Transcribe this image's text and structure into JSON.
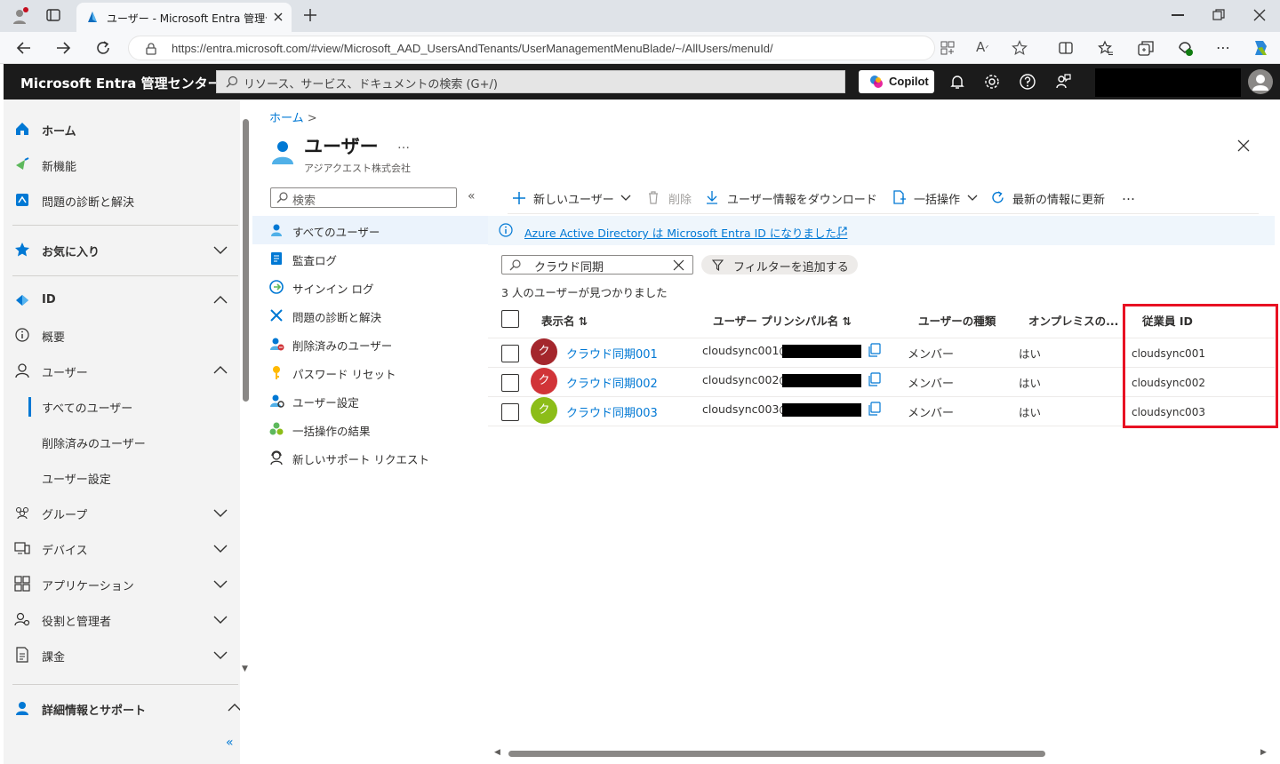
{
  "browser": {
    "tab_title": "ユーザー - Microsoft Entra 管理センター",
    "url": "https://entra.microsoft.com/#view/Microsoft_AAD_UsersAndTenants/UserManagementMenuBlade/~/AllUsers/menuId/"
  },
  "header": {
    "brand": "Microsoft Entra 管理センター",
    "search_placeholder": "リソース、サービス、ドキュメントの検索 (G+/)",
    "copilot_label": "Copilot"
  },
  "leftnav": {
    "items": [
      {
        "label": "ホーム",
        "icon": "home-icon"
      },
      {
        "label": "新機能",
        "icon": "whats-new-icon"
      },
      {
        "label": "問題の診断と解決",
        "icon": "diagnose-icon"
      },
      {
        "label": "お気に入り",
        "icon": "star-icon"
      },
      {
        "label": "ID",
        "icon": "identity-icon"
      },
      {
        "label": "概要",
        "icon": "info-icon"
      },
      {
        "label": "ユーザー",
        "icon": "user-icon"
      },
      {
        "label": "すべてのユーザー"
      },
      {
        "label": "削除済みのユーザー"
      },
      {
        "label": "ユーザー設定"
      },
      {
        "label": "グループ",
        "icon": "groups-icon"
      },
      {
        "label": "デバイス",
        "icon": "devices-icon"
      },
      {
        "label": "アプリケーション",
        "icon": "apps-icon"
      },
      {
        "label": "役割と管理者",
        "icon": "roles-icon"
      },
      {
        "label": "課金",
        "icon": "billing-icon"
      },
      {
        "label": "詳細情報とサポート",
        "icon": "support-icon"
      }
    ]
  },
  "page": {
    "breadcrumb": "ホーム",
    "title": "ユーザー",
    "subtitle": "アジアクエスト株式会社",
    "search_placeholder": "検索"
  },
  "blade_menu": [
    {
      "label": "すべてのユーザー",
      "icon": "user-icon"
    },
    {
      "label": "監査ログ",
      "icon": "audit-log-icon"
    },
    {
      "label": "サインイン ログ",
      "icon": "signin-log-icon"
    },
    {
      "label": "問題の診断と解決",
      "icon": "diagnose-icon"
    },
    {
      "label": "削除済みのユーザー",
      "icon": "deleted-user-icon"
    },
    {
      "label": "パスワード リセット",
      "icon": "key-icon"
    },
    {
      "label": "ユーザー設定",
      "icon": "user-settings-icon"
    },
    {
      "label": "一括操作の結果",
      "icon": "bulk-results-icon"
    },
    {
      "label": "新しいサポート リクエスト",
      "icon": "support-request-icon"
    }
  ],
  "toolbar": {
    "new_user": "新しいユーザー",
    "delete": "削除",
    "download": "ユーザー情報をダウンロード",
    "bulk": "一括操作",
    "refresh": "最新の情報に更新",
    "more": "…"
  },
  "banner": "Azure Active Directory は Microsoft Entra ID になりました。",
  "filter": {
    "value": "クラウド同期",
    "add_filter": "フィルターを追加する"
  },
  "result_count": "3 人のユーザーが見つかりました",
  "table": {
    "headers": [
      "表示名 ⇅",
      "ユーザー プリンシパル名 ⇅",
      "ユーザーの種類",
      "オンプレミスの...",
      "従業員 ID"
    ],
    "rows": [
      {
        "initial": "ク",
        "avatar_color": "#a4262c",
        "name": "クラウド同期001",
        "upn": "cloudsync001@",
        "type": "メンバー",
        "onprem": "はい",
        "employee_id": "cloudsync001"
      },
      {
        "initial": "ク",
        "avatar_color": "#d13438",
        "name": "クラウド同期002",
        "upn": "cloudsync002@",
        "type": "メンバー",
        "onprem": "はい",
        "employee_id": "cloudsync002"
      },
      {
        "initial": "ク",
        "avatar_color": "#8cbd18",
        "name": "クラウド同期003",
        "upn": "cloudsync003@",
        "type": "メンバー",
        "onprem": "はい",
        "employee_id": "cloudsync003"
      }
    ]
  },
  "colors": {
    "accent": "#0078d4",
    "highlight": "#e81123",
    "header_bg": "#1b1b1b"
  }
}
